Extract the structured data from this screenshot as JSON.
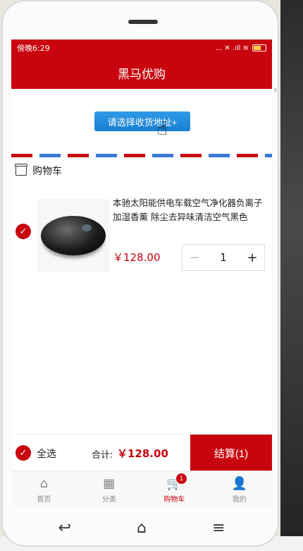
{
  "status": {
    "time": "傍晚6:29",
    "icons": "... ✕ .ıll ≋"
  },
  "header": {
    "title": "黑马优购"
  },
  "address": {
    "button_label": "请选择收货地址+"
  },
  "cart": {
    "section_title": "购物车",
    "items": [
      {
        "name": "本驰太阳能供电车载空气净化器负离子加湿香薰 除尘去异味清洁空气黑色",
        "price": "￥128.00",
        "quantity": "1",
        "minus": "−",
        "plus": "+",
        "checked": true
      }
    ]
  },
  "checkout": {
    "select_all_label": "全选",
    "total_label": "合计:",
    "total_value": "￥128.00",
    "button_label": "结算(1)"
  },
  "tabbar": {
    "tabs": [
      {
        "label": "首页",
        "icon": "home-icon",
        "active": false
      },
      {
        "label": "分类",
        "icon": "grid-icon",
        "active": false
      },
      {
        "label": "购物车",
        "icon": "cart-icon",
        "active": true,
        "badge": "1"
      },
      {
        "label": "我的",
        "icon": "user-icon",
        "active": false
      }
    ]
  },
  "colors": {
    "brand": "#c8050e",
    "address_button": "#1a7fd0"
  }
}
